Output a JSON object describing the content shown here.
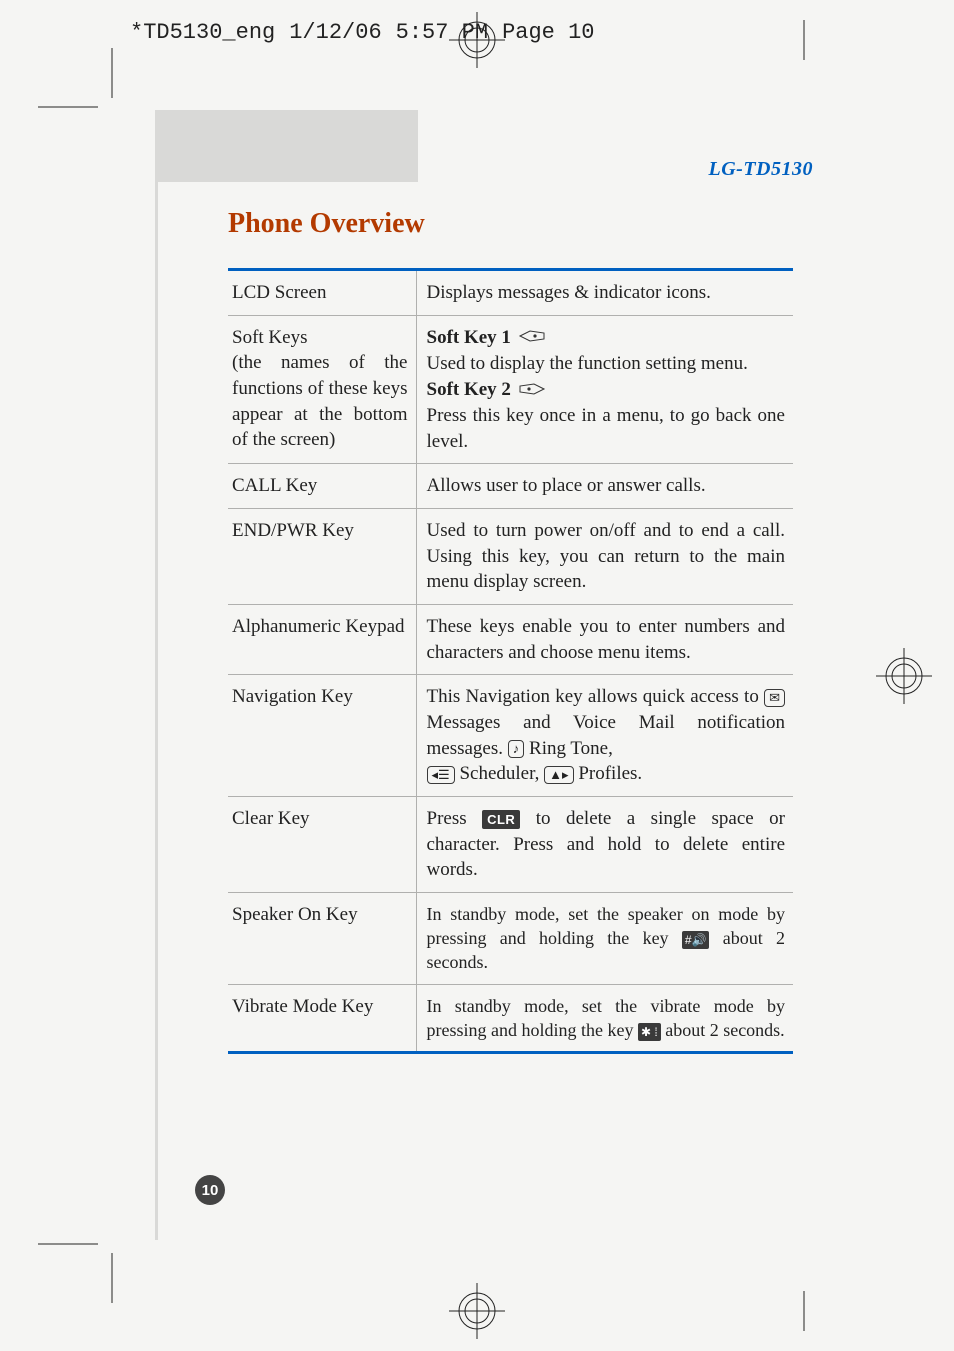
{
  "crop_header": {
    "filename": "*TD5130_eng",
    "date": "1/12/06",
    "time": "5:57 PM",
    "page_label": "Page 10"
  },
  "model_label": "LG-TD5130",
  "section_title": "Phone Overview",
  "page_number": "10",
  "rows": [
    {
      "left": "LCD Screen",
      "right_plain": "Displays messages & indicator icons."
    },
    {
      "left": "Soft Keys\n(the names of the functions of these keys appear at the bottom of the screen)",
      "softkey1_label": "Soft Key 1",
      "softkey1_desc": "Used to display the function setting menu.",
      "softkey2_label": "Soft Key 2",
      "softkey2_desc": "Press this key once in a menu, to go back one level."
    },
    {
      "left": "CALL Key",
      "right_plain": "Allows user to place or answer calls."
    },
    {
      "left": "END/PWR Key",
      "right_plain": "Used to turn power on/off and to end a call. Using this key, you can return to the main menu display screen."
    },
    {
      "left": "Alphanumeric Keypad",
      "right_plain": "These keys enable you to enter numbers and characters and choose menu items."
    },
    {
      "left": "Navigation Key",
      "nav_intro": "This Navigation key allows quick access to",
      "nav_messages": " Messages and Voice Mail notification messages. ",
      "nav_ringtone": " Ring Tone,",
      "nav_scheduler": " Scheduler, ",
      "nav_profiles": " Profiles."
    },
    {
      "left": "Clear Key",
      "clear_pre": "Press ",
      "clear_key_label": "CLR",
      "clear_post": " to delete a single space or character. Press and hold to delete entire words."
    },
    {
      "left": "Speaker On Key",
      "speaker_pre": "In standby mode, set the speaker on mode by pressing and holding the key ",
      "speaker_post": " about 2 seconds."
    },
    {
      "left": "Vibrate Mode Key",
      "vibrate_pre": "In standby mode, set the vibrate mode by pressing and holding the key ",
      "vibrate_post": " about 2 seconds."
    }
  ]
}
